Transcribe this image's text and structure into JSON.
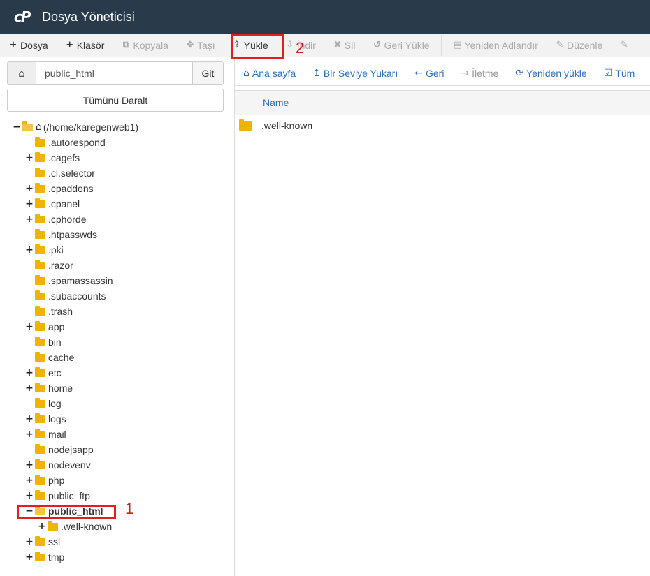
{
  "header": {
    "title": "Dosya Yöneticisi",
    "logo": "cP"
  },
  "toolbar": {
    "buttons": [
      {
        "label": "Dosya",
        "icon": "+",
        "disabled": false
      },
      {
        "label": "Klasör",
        "icon": "+",
        "disabled": false
      },
      {
        "label": "Kopyala",
        "icon": "⧉",
        "disabled": true
      },
      {
        "label": "Taşı",
        "icon": "✥",
        "disabled": true
      },
      {
        "label": "Yükle",
        "icon": "⇪",
        "disabled": false
      },
      {
        "label": "İndir",
        "icon": "⇩",
        "disabled": true
      },
      {
        "label": "Sil",
        "icon": "✖",
        "disabled": true
      },
      {
        "label": "Geri Yükle",
        "icon": "↺",
        "disabled": true
      },
      {
        "label": "Yeniden Adlandır",
        "icon": "▤",
        "disabled": true
      },
      {
        "label": "Düzenle",
        "icon": "✎",
        "disabled": true
      },
      {
        "label": "",
        "icon": "✎",
        "disabled": true
      }
    ]
  },
  "address": {
    "value": "public_html",
    "go_label": "Git"
  },
  "tree": {
    "collapse_label": "Tümünü Daralt",
    "root_label": "(/home/karegenweb1)",
    "items": [
      {
        "label": ".autorespond",
        "toggle": ""
      },
      {
        "label": ".cagefs",
        "toggle": "+"
      },
      {
        "label": ".cl.selector",
        "toggle": ""
      },
      {
        "label": ".cpaddons",
        "toggle": "+"
      },
      {
        "label": ".cpanel",
        "toggle": "+"
      },
      {
        "label": ".cphorde",
        "toggle": "+"
      },
      {
        "label": ".htpasswds",
        "toggle": ""
      },
      {
        "label": ".pki",
        "toggle": "+"
      },
      {
        "label": ".razor",
        "toggle": ""
      },
      {
        "label": ".spamassassin",
        "toggle": ""
      },
      {
        "label": ".subaccounts",
        "toggle": ""
      },
      {
        "label": ".trash",
        "toggle": ""
      },
      {
        "label": "app",
        "toggle": "+"
      },
      {
        "label": "bin",
        "toggle": ""
      },
      {
        "label": "cache",
        "toggle": ""
      },
      {
        "label": "etc",
        "toggle": "+"
      },
      {
        "label": "home",
        "toggle": "+"
      },
      {
        "label": "log",
        "toggle": ""
      },
      {
        "label": "logs",
        "toggle": "+"
      },
      {
        "label": "mail",
        "toggle": "+"
      },
      {
        "label": "nodejsapp",
        "toggle": ""
      },
      {
        "label": "nodevenv",
        "toggle": "+"
      },
      {
        "label": "php",
        "toggle": "+"
      },
      {
        "label": "public_ftp",
        "toggle": "+"
      },
      {
        "label": "public_html",
        "toggle": "−"
      },
      {
        "label": ".well-known",
        "toggle": "+"
      },
      {
        "label": "ssl",
        "toggle": "+"
      },
      {
        "label": "tmp",
        "toggle": "+"
      }
    ]
  },
  "annotations": {
    "marker_1": "1",
    "marker_2": "2"
  },
  "nav": {
    "buttons": [
      {
        "label": "Ana sayfa",
        "icon": "⌂",
        "disabled": false
      },
      {
        "label": "Bir Seviye Yukarı",
        "icon": "↥",
        "disabled": false
      },
      {
        "label": "Geri",
        "icon": "←",
        "disabled": false
      },
      {
        "label": "İletme",
        "icon": "→",
        "disabled": true
      },
      {
        "label": "Yeniden yükle",
        "icon": "⟳",
        "disabled": false
      },
      {
        "label": "Tüm",
        "icon": "☑",
        "disabled": false
      }
    ]
  },
  "files": {
    "column_name": "Name",
    "rows": [
      {
        "name": ".well-known"
      }
    ]
  }
}
